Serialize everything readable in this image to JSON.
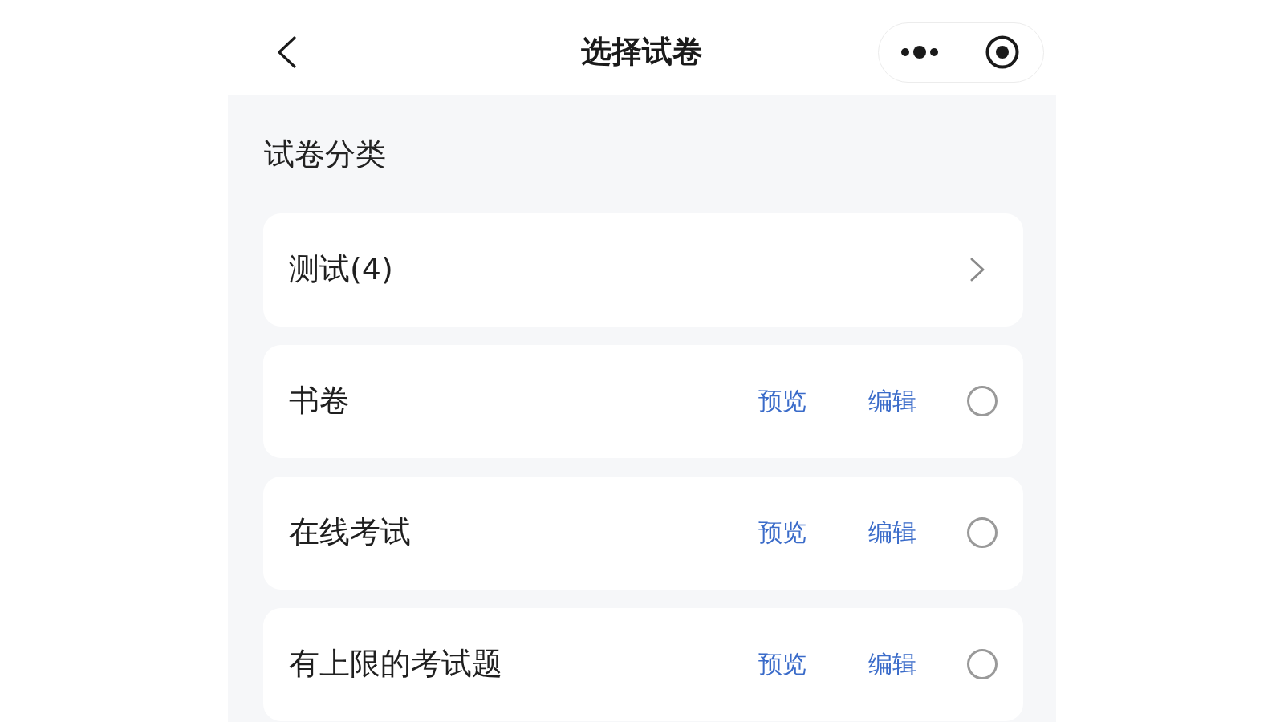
{
  "header": {
    "title": "选择试卷"
  },
  "section_title": "试卷分类",
  "category": {
    "label": "测试(4)"
  },
  "papers": [
    {
      "name": "书卷",
      "preview_label": "预览",
      "edit_label": "编辑",
      "selected": false
    },
    {
      "name": "在线考试",
      "preview_label": "预览",
      "edit_label": "编辑",
      "selected": false
    },
    {
      "name": "有上限的考试题",
      "preview_label": "预览",
      "edit_label": "编辑",
      "selected": false
    }
  ]
}
